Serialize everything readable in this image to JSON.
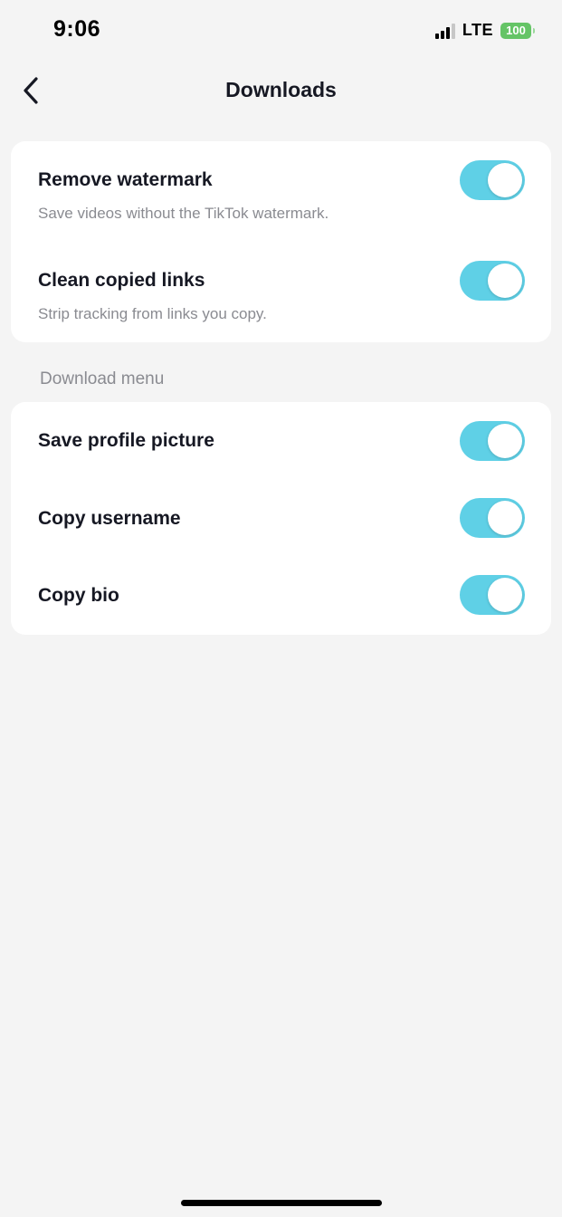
{
  "status_bar": {
    "time": "9:06",
    "network": "LTE",
    "battery": "100"
  },
  "nav": {
    "title": "Downloads",
    "back_icon": "chevron-left-icon"
  },
  "settings": [
    {
      "label": "Remove watermark",
      "description": "Save videos without the TikTok watermark.",
      "enabled": true
    },
    {
      "label": "Clean copied links",
      "description": "Strip tracking from links you copy.",
      "enabled": true
    }
  ],
  "download_menu": {
    "header": "Download menu",
    "items": [
      {
        "label": "Save profile picture",
        "enabled": true
      },
      {
        "label": "Copy username",
        "enabled": true
      },
      {
        "label": "Copy bio",
        "enabled": true
      }
    ]
  },
  "colors": {
    "toggle_on": "#5fd0e6",
    "background": "#f4f4f4",
    "battery": "#65c466"
  }
}
